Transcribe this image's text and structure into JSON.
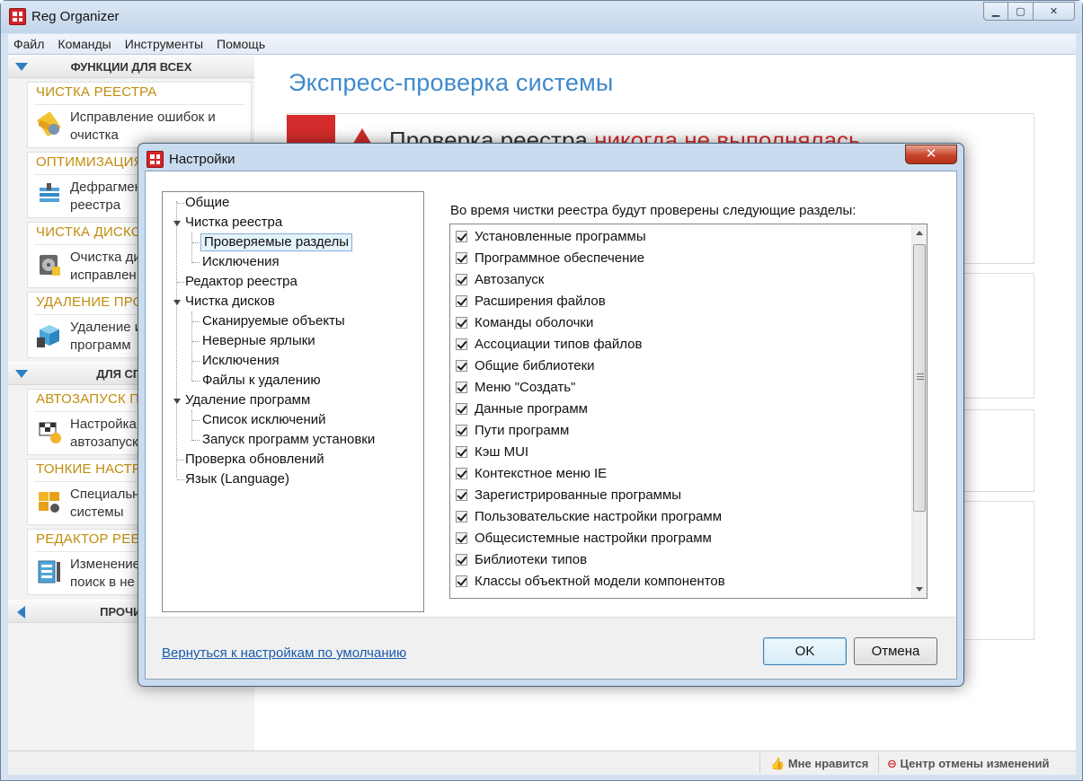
{
  "window": {
    "title": "Reg Organizer",
    "controls": {
      "minimize": "▁",
      "maximize": "▢",
      "close": "✕"
    }
  },
  "menu": [
    "Файл",
    "Команды",
    "Инструменты",
    "Помощь"
  ],
  "sidebar": {
    "section1": "ФУНКЦИИ ДЛЯ ВСЕХ",
    "section2": "ДЛЯ СПЕЦИ",
    "section3": "ПРОЧИЕ Ф",
    "cards": [
      {
        "title": "ЧИСТКА РЕЕСТРА",
        "line1": "Исправление ошибок и",
        "line2": "очистка",
        "icon": "registry-cleaner-icon"
      },
      {
        "title": "ОПТИМИЗАЦИЯ",
        "line1": "Дефрагмен",
        "line2": "реестра",
        "icon": "registry-defrag-icon"
      },
      {
        "title": "ЧИСТКА ДИСКО",
        "line1": "Очистка ди",
        "line2": "исправлен",
        "icon": "disk-cleanup-icon"
      },
      {
        "title": "УДАЛЕНИЕ ПРО",
        "line1": "Удаление и",
        "line2": "программ",
        "icon": "uninstall-box-icon"
      },
      {
        "title": "АВТОЗАПУСК П",
        "line1": "Настройка",
        "line2": "автозапуск",
        "icon": "autorun-flag-icon"
      },
      {
        "title": "ТОНКИЕ НАСТР",
        "line1": "Специальн",
        "line2": "системы",
        "icon": "windows-tweaks-icon"
      },
      {
        "title": "РЕДАКТОР РЕЕ",
        "line1": "Изменение",
        "line2": "поиск в не",
        "icon": "registry-editor-icon"
      }
    ]
  },
  "main": {
    "title": "Экспресс-проверка системы",
    "registry_status_prefix": "Проверка реестра",
    "registry_status_bad": "никогда не выполнялась"
  },
  "statusbar": {
    "like": "Мне нравится",
    "undo_center": "Центр отмены изменений"
  },
  "dialog": {
    "title": "Настройки",
    "close": "✕",
    "tree": [
      {
        "label": "Общие",
        "level": 0
      },
      {
        "label": "Чистка реестра",
        "level": 0,
        "expanded": true
      },
      {
        "label": "Проверяемые разделы",
        "level": 1,
        "selected": true
      },
      {
        "label": "Исключения",
        "level": 1
      },
      {
        "label": "Редактор реестра",
        "level": 0
      },
      {
        "label": "Чистка дисков",
        "level": 0,
        "expanded": true
      },
      {
        "label": "Сканируемые объекты",
        "level": 1
      },
      {
        "label": "Неверные ярлыки",
        "level": 1
      },
      {
        "label": "Исключения",
        "level": 1
      },
      {
        "label": "Файлы к удалению",
        "level": 1
      },
      {
        "label": "Удаление программ",
        "level": 0,
        "expanded": true
      },
      {
        "label": "Список исключений",
        "level": 1
      },
      {
        "label": "Запуск программ установки",
        "level": 1
      },
      {
        "label": "Проверка обновлений",
        "level": 0
      },
      {
        "label": "Язык (Language)",
        "level": 0
      }
    ],
    "list_caption": "Во время чистки реестра будут проверены следующие разделы:",
    "sections": [
      "Установленные программы",
      "Программное обеспечение",
      "Автозапуск",
      "Расширения файлов",
      "Команды оболочки",
      "Ассоциации типов файлов",
      "Общие библиотеки",
      "Меню \"Создать\"",
      "Данные программ",
      "Пути программ",
      "Кэш MUI",
      "Контекстное меню IE",
      "Зарегистрированные программы",
      "Пользовательские настройки программ",
      "Общесистемные настройки программ",
      "Библиотеки типов",
      "Классы объектной модели компонентов"
    ],
    "all_checked": true,
    "reset_link": "Вернуться к настройкам по умолчанию",
    "ok": "OK",
    "cancel": "Отмена"
  },
  "colors": {
    "accent_blue": "#3f8acb",
    "card_title": "#c18c0c",
    "warning_red": "#d42c2c",
    "link_blue": "#1a5cab"
  }
}
